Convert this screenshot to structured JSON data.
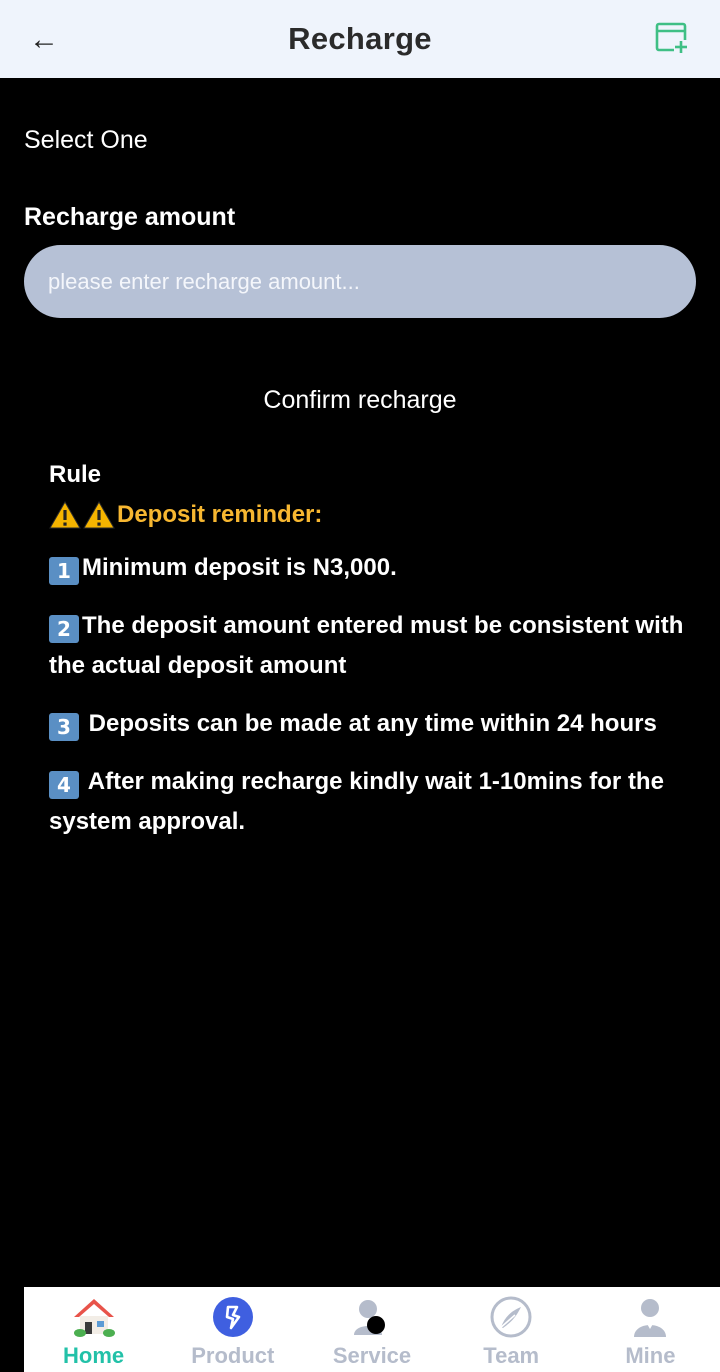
{
  "header": {
    "title": "Recharge",
    "back_icon": "arrow-left-icon",
    "record_icon": "add-card-icon"
  },
  "form": {
    "select_label": "Select One",
    "amount_label": "Recharge amount",
    "amount_placeholder": "please enter recharge amount...",
    "amount_value": "",
    "confirm_label": "Confirm recharge"
  },
  "rules": {
    "title": "Rule",
    "reminder": "Deposit reminder:",
    "items": [
      {
        "num": "1",
        "text": "Minimum deposit is N3,000."
      },
      {
        "num": "2",
        "text": "The deposit amount entered must be consistent with the actual deposit amount"
      },
      {
        "num": "3",
        "text": " Deposits can be made at any time within 24 hours"
      },
      {
        "num": "4",
        "text": " After making recharge kindly wait 1-10mins for the system approval."
      }
    ]
  },
  "nav": {
    "items": [
      {
        "label": "Home",
        "icon": "house-icon",
        "active": true
      },
      {
        "label": "Product",
        "icon": "product-icon",
        "active": false
      },
      {
        "label": "Service",
        "icon": "service-icon",
        "active": false
      },
      {
        "label": "Team",
        "icon": "team-icon",
        "active": false
      },
      {
        "label": "Mine",
        "icon": "user-icon",
        "active": false
      }
    ]
  },
  "colors": {
    "header_bg": "#eff4fc",
    "input_bg": "#b6c1d6",
    "warning": "#f7b731",
    "nav_active": "#22c1a8",
    "nav_inactive": "#b5bccb"
  }
}
